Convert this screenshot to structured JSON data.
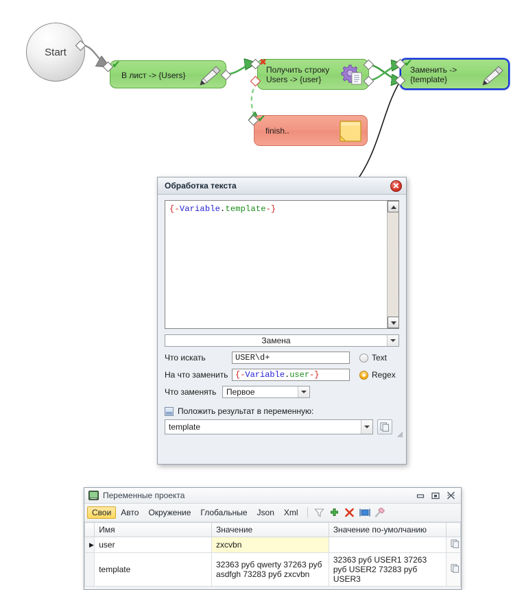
{
  "flow": {
    "start": {
      "label": "Start"
    },
    "nodes": [
      {
        "id": "list",
        "label": "В лист -> {Users}",
        "icon": "pen-icon",
        "state": "ok"
      },
      {
        "id": "getline",
        "label": "Получить строку\nUsers -> {user}",
        "icon": "gear-document-icon",
        "state": "error"
      },
      {
        "id": "replace",
        "label": "Заменить ->\n{template}",
        "icon": "pen-icon",
        "state": "ok",
        "selected": true
      },
      {
        "id": "finish",
        "label": "finish..",
        "icon": "note-icon",
        "state": "ok"
      }
    ],
    "colors": {
      "green": "#93d977",
      "red": "#f29683",
      "selection": "#1431d8",
      "link": "#2f9e2f"
    }
  },
  "dialog": {
    "title": "Обработка текста",
    "close_label": "×",
    "editor": {
      "text": "{-Variable.template-}",
      "parts": {
        "open": "{-",
        "ns": "Variable",
        "dot": ".",
        "var": "template",
        "close": "-}"
      }
    },
    "mode_combo": {
      "value": "Замена"
    },
    "fields": {
      "search_label": "Что искать",
      "search_value": "USER\\d+",
      "replace_label": "На что заменить",
      "replace_parts": {
        "open": "{-",
        "ns": "Variable",
        "dot": ".",
        "var": "user",
        "close": "-}"
      },
      "scope_label": "Что заменять",
      "scope_value": "Первое"
    },
    "radios": [
      {
        "label": "Text",
        "checked": false
      },
      {
        "label": "Regex",
        "checked": true
      }
    ],
    "result": {
      "checkbox_label": "Положить результат в переменную:",
      "value": "template"
    }
  },
  "vars_window": {
    "title": "Переменные проекта",
    "window_buttons": {
      "minimize": "▭",
      "restore": "▣",
      "close": "✕"
    },
    "tabs": [
      {
        "label": "Свои",
        "selected": true
      },
      {
        "label": "Авто",
        "selected": false
      },
      {
        "label": "Окружение",
        "selected": false
      },
      {
        "label": "Глобальные",
        "selected": false
      },
      {
        "label": "Json",
        "selected": false
      },
      {
        "label": "Xml",
        "selected": false
      }
    ],
    "tools": [
      {
        "name": "filter-icon"
      },
      {
        "name": "add-icon"
      },
      {
        "name": "delete-icon"
      },
      {
        "name": "rename-icon"
      },
      {
        "name": "eraser-icon"
      }
    ],
    "table": {
      "columns": [
        "Имя",
        "Значение",
        "Значение по-умолчанию"
      ],
      "rows": [
        {
          "selected": true,
          "name": "user",
          "value": "zxcvbn",
          "default": ""
        },
        {
          "selected": false,
          "name": "template",
          "value": "32363 руб qwerty 37263 руб asdfgh 73283 руб zxcvbn",
          "default": "32363 руб USER1 37263 руб USER2 73283 руб USER3"
        }
      ]
    }
  }
}
